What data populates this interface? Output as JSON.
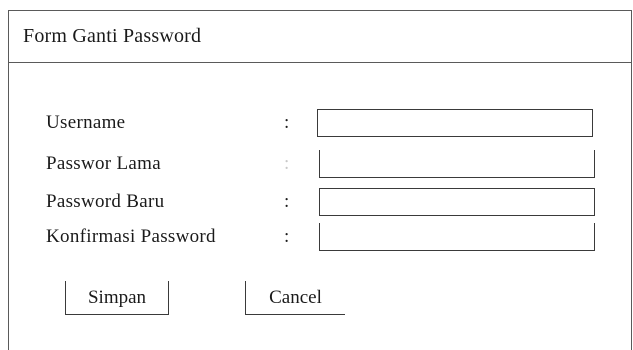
{
  "form": {
    "title": "Form Ganti Password",
    "fields": [
      {
        "label": "Username",
        "separator": ":",
        "value": ""
      },
      {
        "label": "Passwor Lama",
        "separator": ":",
        "value": ""
      },
      {
        "label": "Password Baru",
        "separator": ":",
        "value": ""
      },
      {
        "label": "Konfirmasi Password",
        "separator": ":",
        "value": ""
      }
    ],
    "buttons": {
      "save_label": "Simpan",
      "cancel_label": "Cancel"
    }
  }
}
